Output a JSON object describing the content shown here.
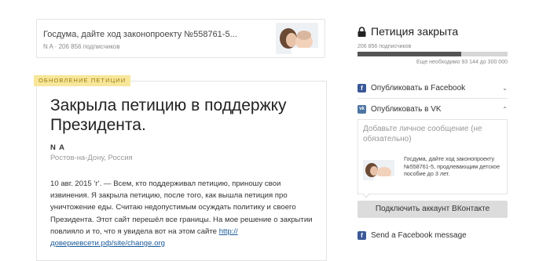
{
  "petition": {
    "title": "Госдума, дайте ход законопроекту №558761-5...",
    "meta": "N A · 206 856 подписчиков"
  },
  "update": {
    "tag": "ОБНОВЛЕНИЕ ПЕТИЦИИ",
    "title": "Закрыла петицию в поддержку Президента.",
    "author": "N A",
    "location": "Ростов-на-Дону, Россия",
    "body": "10 авг. 2015 'г'. — Всем, кто поддерживал петицию, приношу свои извинения. Я закрыла петицию, после того, как вышла петиция про уничтожение еды. Считаю недопустимым осуждать политику и своего Президента. Этот сайт перешёл все границы. На мое решение о закрытии повлияло и то, что я увидела вот на этом сайте ",
    "link": "http:// довериевсети.рф/site/change.org"
  },
  "status": {
    "closed_label": "Петиция закрыта",
    "signatures": "206 856 подписчиков",
    "needed": "Еще необходимо 93 144 до 300 000",
    "progress_fraction": 0.6895
  },
  "share": {
    "facebook_label": "Опубликовать в Facebook",
    "vk_label": "Опубликовать в VK",
    "vk_placeholder": "Добавьте личное сообщение (не обязательно)",
    "vk_preview_text": "Госдума, дайте ход законопроекту №558761-5, продлевающим детское пособие до 3 лет.",
    "vk_connect": "Подключить аккаунт ВКонтакте",
    "fb_message": "Send a Facebook message"
  },
  "icons": {
    "lock": "lock-icon",
    "facebook": "facebook-icon",
    "vk": "vk-icon",
    "chevron": "chevron-down-icon"
  },
  "colors": {
    "tag_bg": "#f8e79a",
    "progress_fill": "#555555",
    "facebook": "#3b5998",
    "vk": "#4c75a3"
  }
}
